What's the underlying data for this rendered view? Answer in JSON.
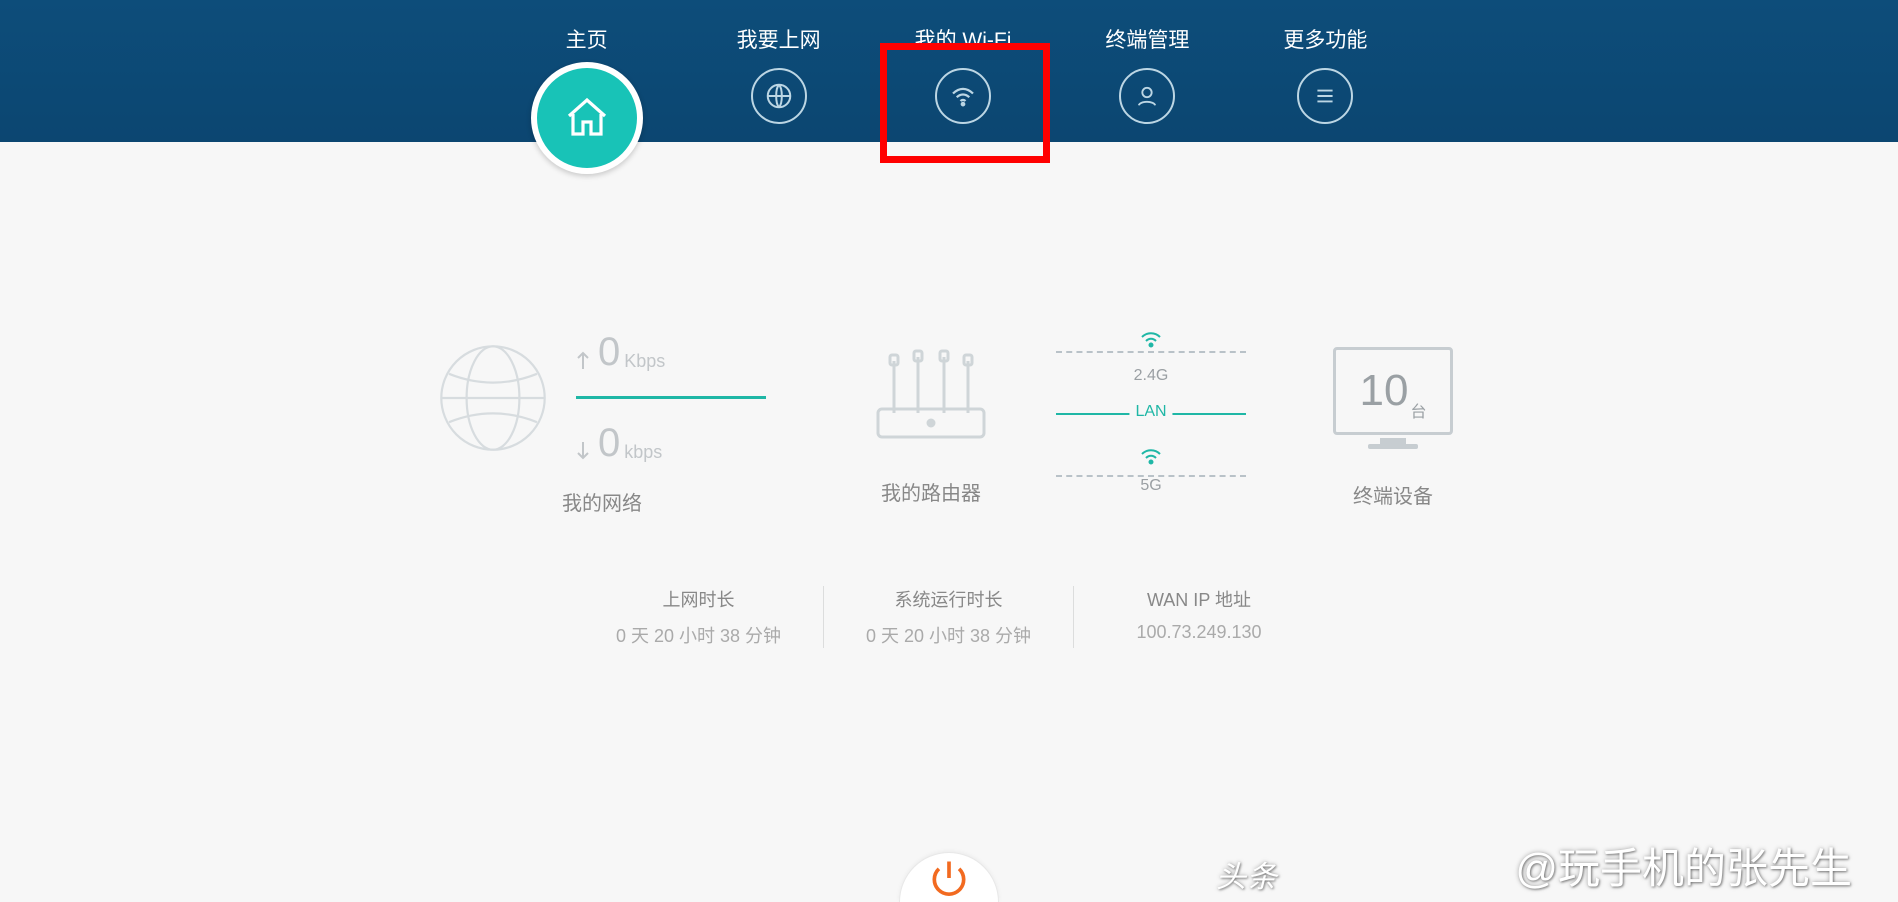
{
  "nav": {
    "home": "主页",
    "net": "我要上网",
    "wifi": "我的 Wi-Fi",
    "dev": "终端管理",
    "more": "更多功能"
  },
  "highlight_target": "wifi",
  "dashboard": {
    "network": {
      "title": "我的网络",
      "up_value": "0",
      "up_unit": "Kbps",
      "down_value": "0",
      "down_unit": "kbps"
    },
    "router": {
      "title": "我的路由器"
    },
    "lan": {
      "band_top": "2.4G",
      "mid": "LAN",
      "band_bot": "5G"
    },
    "clients": {
      "title": "终端设备",
      "count": "10",
      "unit": "台"
    }
  },
  "stats": [
    {
      "label": "上网时长",
      "value": "0 天 20 小时 38 分钟"
    },
    {
      "label": "系统运行时长",
      "value": "0 天 20 小时 38 分钟"
    },
    {
      "label": "WAN IP 地址",
      "value": "100.73.249.130"
    }
  ],
  "watermark": {
    "a": "头条",
    "b": "@玩手机的张先生"
  }
}
